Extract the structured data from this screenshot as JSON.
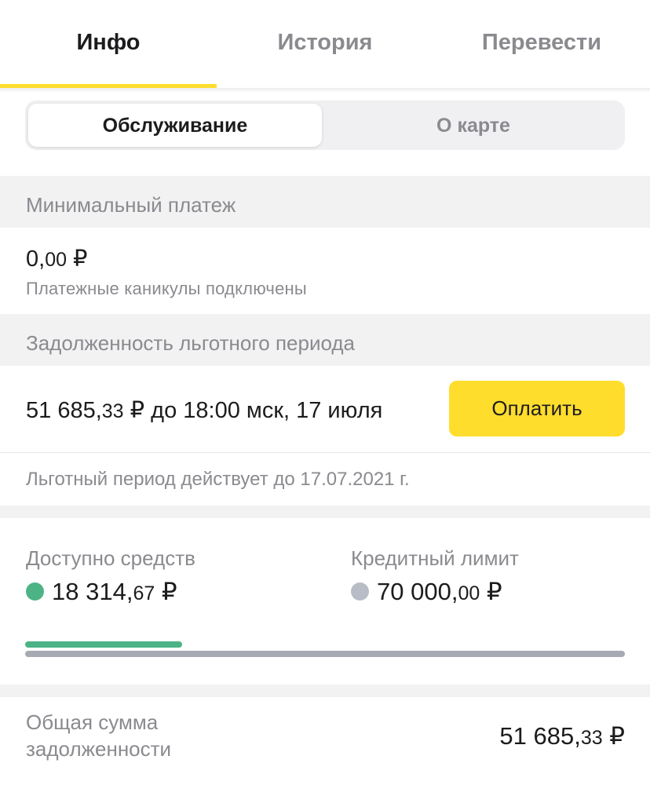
{
  "tabs": [
    {
      "label": "Инфо",
      "active": true
    },
    {
      "label": "История",
      "active": false
    },
    {
      "label": "Перевести",
      "active": false
    }
  ],
  "segment": {
    "options": [
      "Обслуживание",
      "О карте"
    ],
    "selected": "Обслуживание"
  },
  "min_payment": {
    "header": "Минимальный платеж",
    "amount_main": "0,",
    "amount_kop": "00",
    "currency": " ₽",
    "note": "Платежные каникулы подключены"
  },
  "grace": {
    "header": "Задолженность льготного периода",
    "amount_main": "51 685,",
    "amount_kop": "33",
    "amount_rest": " ₽ до 18:00 мск, 17 июля",
    "pay_label": "Оплатить",
    "note": "Льготный период действует до 17.07.2021 г."
  },
  "credit": {
    "available_label": "Доступно средств",
    "available_main": "18 314,",
    "available_kop": "67",
    "limit_label": "Кредитный лимит",
    "limit_main": "70 000,",
    "limit_kop": "00",
    "currency": " ₽",
    "available_fraction": 0.262
  },
  "total": {
    "label": "Общая сумма задолженности",
    "amount_main": "51 685,",
    "amount_kop": "33",
    "currency": " ₽"
  },
  "colors": {
    "accent_yellow": "#ffdd2d",
    "available_green": "#4cb387",
    "limit_gray": "#b8bcc6"
  }
}
